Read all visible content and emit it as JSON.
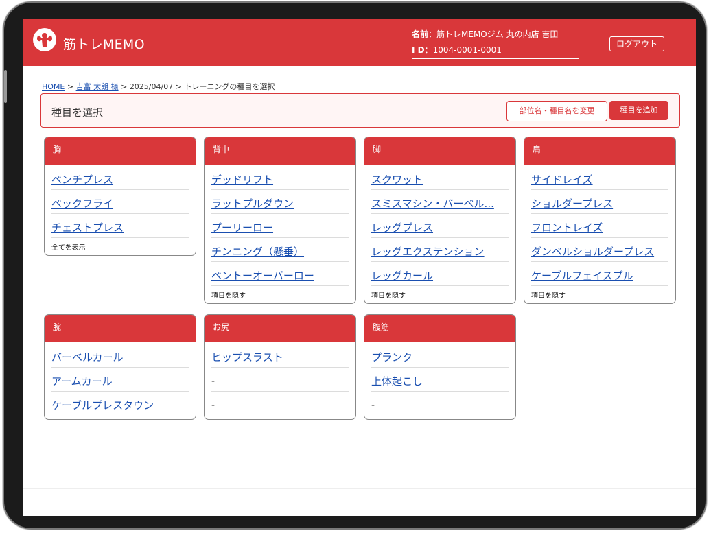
{
  "header": {
    "app_title": "筋トレMEMO",
    "name_label": "名前",
    "name_value": "：筋トレMEMOジム 丸の内店 吉田",
    "id_label": "I D",
    "id_value": "：1004-0001-0001",
    "logout_label": "ログアウト"
  },
  "breadcrumb": {
    "home": "HOME",
    "sep": ">",
    "member": "吉富 太朗 様",
    "date": "2025/04/07",
    "current": "トレーニングの種目を選択"
  },
  "section": {
    "title": "種目を選択",
    "rename_label": "部位名・種目名を変更",
    "add_label": "種目を追加"
  },
  "cards": [
    {
      "title": "胸",
      "items": [
        "ベンチプレス",
        "ペックフライ",
        "チェストプレス"
      ],
      "toggle": "全てを表示"
    },
    {
      "title": "背中",
      "items": [
        "デッドリフト",
        "ラットプルダウン",
        "プーリーロー",
        "チンニング（懸垂）",
        "ベントーオーバーロー"
      ],
      "toggle": "項目を隠す"
    },
    {
      "title": "脚",
      "items": [
        "スクワット",
        "スミスマシン・バーベル...",
        "レッグプレス",
        "レッグエクステンション",
        "レッグカール"
      ],
      "toggle": "項目を隠す"
    },
    {
      "title": "肩",
      "items": [
        "サイドレイズ",
        "ショルダープレス",
        "フロントレイズ",
        "ダンベルショルダープレス",
        "ケーブルフェイスプル"
      ],
      "toggle": "項目を隠す"
    },
    {
      "title": "腕",
      "items": [
        "バーベルカール",
        "アームカール",
        "ケーブルプレスタウン"
      ]
    },
    {
      "title": "お尻",
      "items": [
        "ヒップスラスト",
        "-",
        "-"
      ]
    },
    {
      "title": "腹筋",
      "items": [
        "プランク",
        "上体起こし",
        "-"
      ]
    }
  ],
  "colors": {
    "accent": "#d9373a",
    "link": "#1a4fb0"
  },
  "icons": {
    "logo": "muscle-logo-icon"
  }
}
